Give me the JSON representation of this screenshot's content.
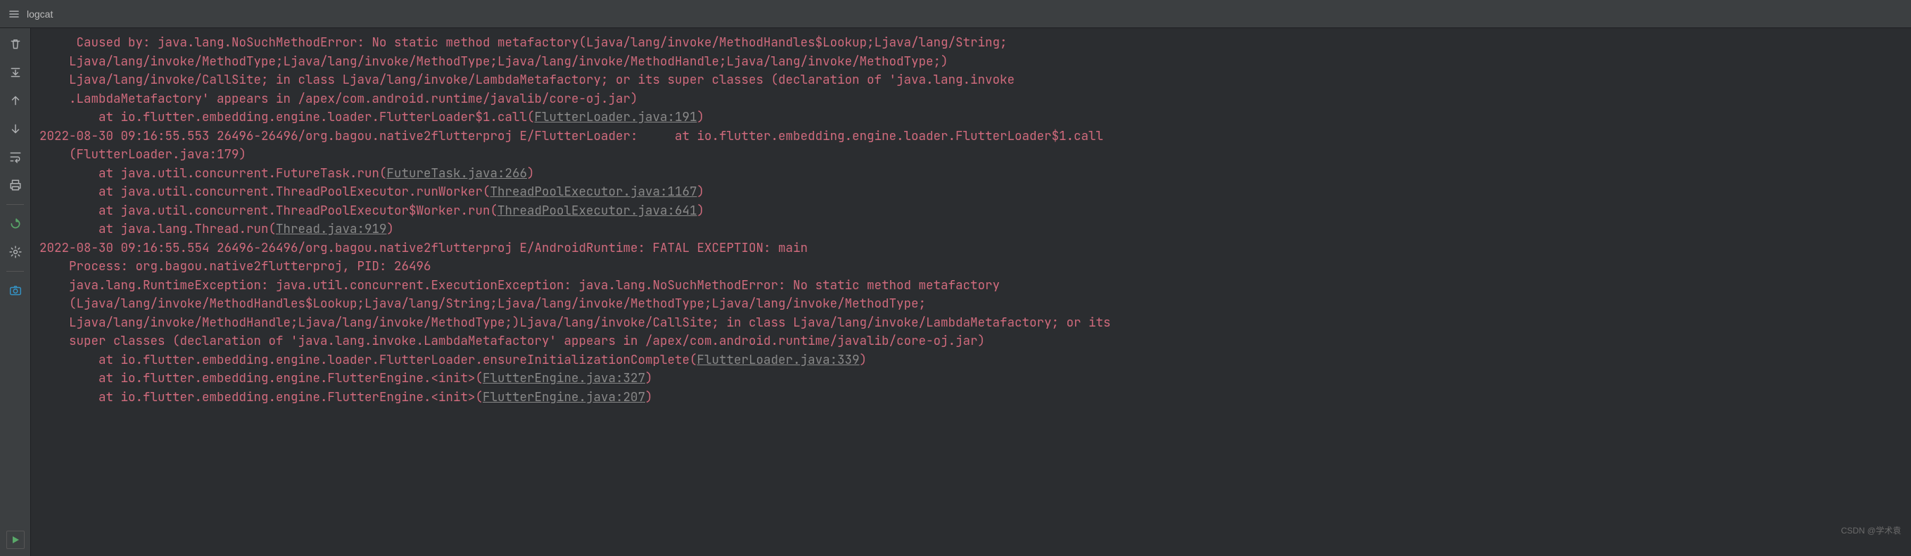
{
  "header": {
    "title": "logcat"
  },
  "log": {
    "lines": [
      {
        "indent": "     ",
        "pre": "Caused by: java.lang.NoSuchMethodError: No static method metafactory(Ljava/lang/invoke/MethodHandles$Lookup;Ljava/lang/String;"
      },
      {
        "indent": "    ",
        "pre": "Ljava/lang/invoke/MethodType;Ljava/lang/invoke/MethodType;Ljava/lang/invoke/MethodHandle;Ljava/lang/invoke/MethodType;)"
      },
      {
        "indent": "    ",
        "pre": "Ljava/lang/invoke/CallSite; in class Ljava/lang/invoke/LambdaMetafactory; or its super classes (declaration of 'java.lang.invoke"
      },
      {
        "indent": "    ",
        "pre": ".LambdaMetafactory' appears in /apex/com.android.runtime/javalib/core-oj.jar)"
      },
      {
        "indent": "        ",
        "pre": "at io.flutter.embedding.engine.loader.FlutterLoader$1.call(",
        "link": "FlutterLoader.java:191",
        "post": ")"
      },
      {
        "indent": "",
        "pre": "2022-08-30 09:16:55.553 26496-26496/org.bagou.native2flutterproj E/FlutterLoader:     at io.flutter.embedding.engine.loader.FlutterLoader$1.call"
      },
      {
        "indent": "    ",
        "pre": "(FlutterLoader.java:179)"
      },
      {
        "indent": "        ",
        "pre": "at java.util.concurrent.FutureTask.run(",
        "link": "FutureTask.java:266",
        "post": ")"
      },
      {
        "indent": "        ",
        "pre": "at java.util.concurrent.ThreadPoolExecutor.runWorker(",
        "link": "ThreadPoolExecutor.java:1167",
        "post": ")"
      },
      {
        "indent": "        ",
        "pre": "at java.util.concurrent.ThreadPoolExecutor$Worker.run(",
        "link": "ThreadPoolExecutor.java:641",
        "post": ")"
      },
      {
        "indent": "        ",
        "pre": "at java.lang.Thread.run(",
        "link": "Thread.java:919",
        "post": ")"
      },
      {
        "indent": "",
        "pre": "2022-08-30 09:16:55.554 26496-26496/org.bagou.native2flutterproj E/AndroidRuntime: FATAL EXCEPTION: main"
      },
      {
        "indent": "    ",
        "pre": "Process: org.bagou.native2flutterproj, PID: 26496"
      },
      {
        "indent": "    ",
        "pre": "java.lang.RuntimeException: java.util.concurrent.ExecutionException: java.lang.NoSuchMethodError: No static method metafactory"
      },
      {
        "indent": "    ",
        "pre": "(Ljava/lang/invoke/MethodHandles$Lookup;Ljava/lang/String;Ljava/lang/invoke/MethodType;Ljava/lang/invoke/MethodType;"
      },
      {
        "indent": "    ",
        "pre": "Ljava/lang/invoke/MethodHandle;Ljava/lang/invoke/MethodType;)Ljava/lang/invoke/CallSite; in class Ljava/lang/invoke/LambdaMetafactory; or its "
      },
      {
        "indent": "    ",
        "pre": "super classes (declaration of 'java.lang.invoke.LambdaMetafactory' appears in /apex/com.android.runtime/javalib/core-oj.jar)"
      },
      {
        "indent": "        ",
        "pre": "at io.flutter.embedding.engine.loader.FlutterLoader.ensureInitializationComplete(",
        "link": "FlutterLoader.java:339",
        "post": ")"
      },
      {
        "indent": "        ",
        "pre": "at io.flutter.embedding.engine.FlutterEngine.<init>(",
        "link": "FlutterEngine.java:327",
        "post": ")"
      },
      {
        "indent": "        ",
        "pre": "at io.flutter.embedding.engine.FlutterEngine.<init>(",
        "link": "FlutterEngine.java:207",
        "post": ")"
      }
    ]
  },
  "watermark": "CSDN @学术袁",
  "toolbar_icons": [
    "trash-icon",
    "scroll-to-end-icon",
    "up-icon",
    "down-icon",
    "soft-wrap-icon",
    "print-icon",
    "restart-icon",
    "settings-icon",
    "screenshot-icon"
  ]
}
